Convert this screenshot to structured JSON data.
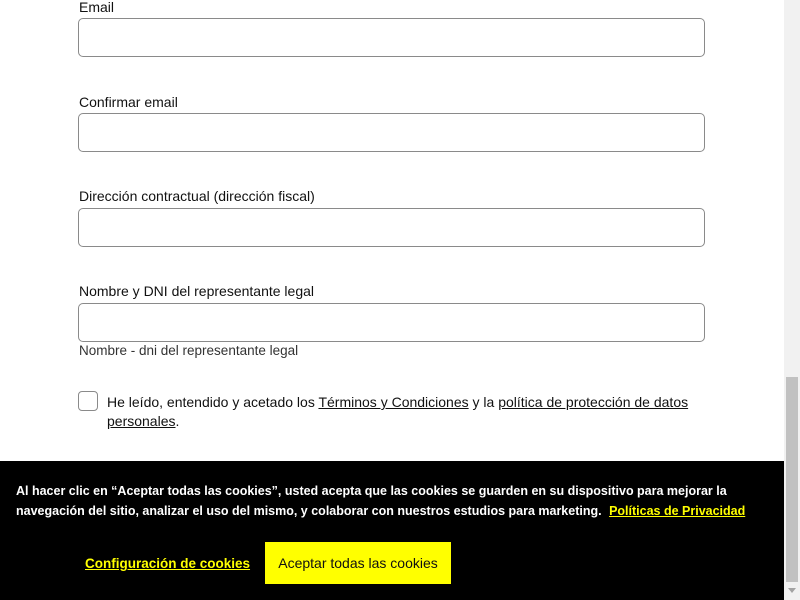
{
  "form": {
    "fields": [
      {
        "label": "Email",
        "value": ""
      },
      {
        "label": "Confirmar email",
        "value": ""
      },
      {
        "label": "Dirección contractual (dirección fiscal)",
        "value": ""
      },
      {
        "label": "Nombre y DNI del representante legal",
        "value": ""
      }
    ],
    "representative_helper": "Nombre - dni del representante legal",
    "terms": {
      "prefix": "He leído, entendido y acetado los ",
      "terms_link": "Términos y Condiciones",
      "middle": " y la ",
      "privacy_link": "política de protección de datos personales",
      "suffix": ".",
      "checked": false
    }
  },
  "cookie_banner": {
    "message": "Al hacer clic en “Aceptar todas las cookies”, usted acepta que las cookies se guarden en su dispositivo para mejorar la navegación del sitio, analizar el uso del mismo, y colaborar con nuestros estudios para marketing.",
    "privacy_link": "Políticas de Privacidad",
    "settings_label": "Configuración de cookies",
    "accept_label": "Aceptar todas las cookies"
  }
}
